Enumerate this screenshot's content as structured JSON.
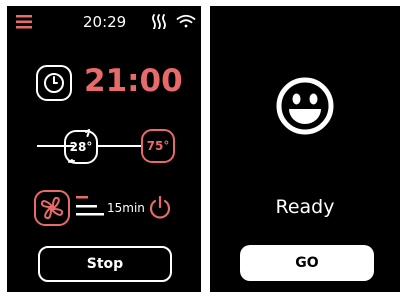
{
  "colors": {
    "accent": "#e86a6a",
    "background": "#000000",
    "foreground": "#ffffff"
  },
  "left_screen": {
    "status_bar": {
      "menu_icon": "hamburger-menu-icon",
      "time": "20:29",
      "heat_icon": "heat-waves-icon",
      "wifi_icon": "wifi-icon"
    },
    "timer": {
      "icon": "clock-icon",
      "value": "21:00"
    },
    "temperature": {
      "current": "28°",
      "target": "75°",
      "current_icon": "thermostat-cycle-icon"
    },
    "fan": {
      "icon": "fan-icon",
      "speed_icon": "fan-speed-bars-icon",
      "duration": "15min",
      "power_icon": "power-icon"
    },
    "stop_label": "Stop"
  },
  "right_screen": {
    "face_icon": "smiley-face-icon",
    "status": "Ready",
    "go_label": "GO"
  }
}
